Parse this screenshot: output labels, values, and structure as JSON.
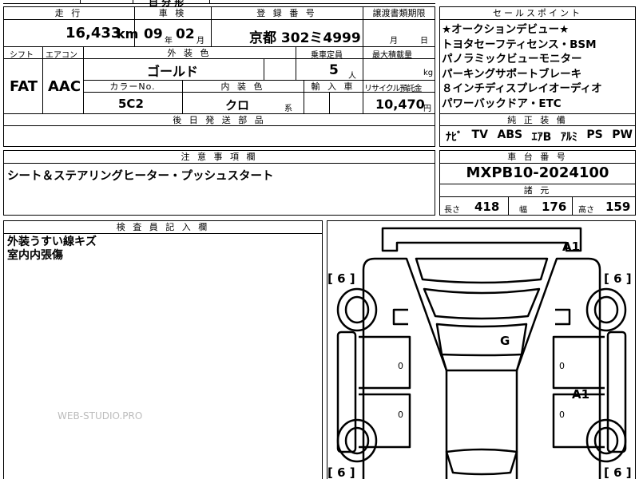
{
  "header": {
    "mileage_label": "走 行",
    "mileage_value": "16,433",
    "mileage_unit": "km",
    "inspection_label": "車 検",
    "inspection_year": "09",
    "inspection_year_unit": "年",
    "inspection_month": "02",
    "inspection_month_unit": "月",
    "registration_label": "登 録 番 号",
    "registration_value": "京都 302ミ4999",
    "transfer_label": "譲渡書類期限",
    "transfer_month_unit": "月",
    "transfer_day_unit": "日",
    "top_partial_text": "自 分 形"
  },
  "row2": {
    "shift_label": "シフト",
    "shift_value": "FAT",
    "aircon_label": "エアコン",
    "aircon_value": "AAC",
    "exterior_color_label": "外 装 色",
    "exterior_color_value": "ゴールド",
    "capacity_label": "乗車定員",
    "capacity_value": "5",
    "capacity_unit": "人",
    "max_load_label": "最大積載量",
    "max_load_unit": "kg",
    "color_no_label": "カラーNo.",
    "color_no_value": "5C2",
    "interior_color_label": "内 装 色",
    "interior_color_value": "クロ",
    "interior_color_suffix": "系",
    "import_label": "輸 入 車",
    "recycle_label": "リサイクル預託金",
    "recycle_value": "10,470",
    "recycle_unit": "円",
    "later_parts_label": "後 日 発 送 部 品"
  },
  "sales_points": {
    "label": "セールスポイント",
    "lines": [
      "★オークションデビュー★",
      "トヨタセーフティセンス・BSM",
      "パノラミックビューモニター",
      "パーキングサポートブレーキ",
      "８インチディスプレイオーディオ",
      "パワーバックドア・ETC"
    ],
    "genuine_label": "純 正 装 備",
    "genuine_items": [
      "ﾅﾋﾞ",
      "TV",
      "ABS",
      "ｴｱB",
      "ｱﾙﾐ",
      "PS",
      "PW"
    ]
  },
  "notes": {
    "label": "注 意 事 項 欄",
    "text": "シート＆ステアリングヒーター・プッシュスタート"
  },
  "chassis": {
    "label": "車 台 番 号",
    "value": "MXPB10-2024100",
    "specs_label": "諸 元",
    "length_label": "長さ",
    "length_value": "418",
    "width_label": "幅",
    "width_value": "176",
    "height_label": "高さ",
    "height_value": "159"
  },
  "inspector": {
    "label": "検 査 員 記 入 欄",
    "lines": [
      "外装うすい線キズ",
      "室内内張傷"
    ]
  },
  "diagram": {
    "tire_label_fl": "[ 6 ]",
    "tire_label_fr": "[ 6 ]",
    "tire_label_rl": "[ 6 ]",
    "tire_label_rr": "[ 6 ]",
    "mark_a1_top": "A1",
    "mark_g": "G",
    "mark_a1_side": "A1",
    "zero_1": "0",
    "zero_2": "0",
    "zero_3": "0",
    "zero_4": "0"
  },
  "watermark": "WEB-STUDIO.PRO"
}
